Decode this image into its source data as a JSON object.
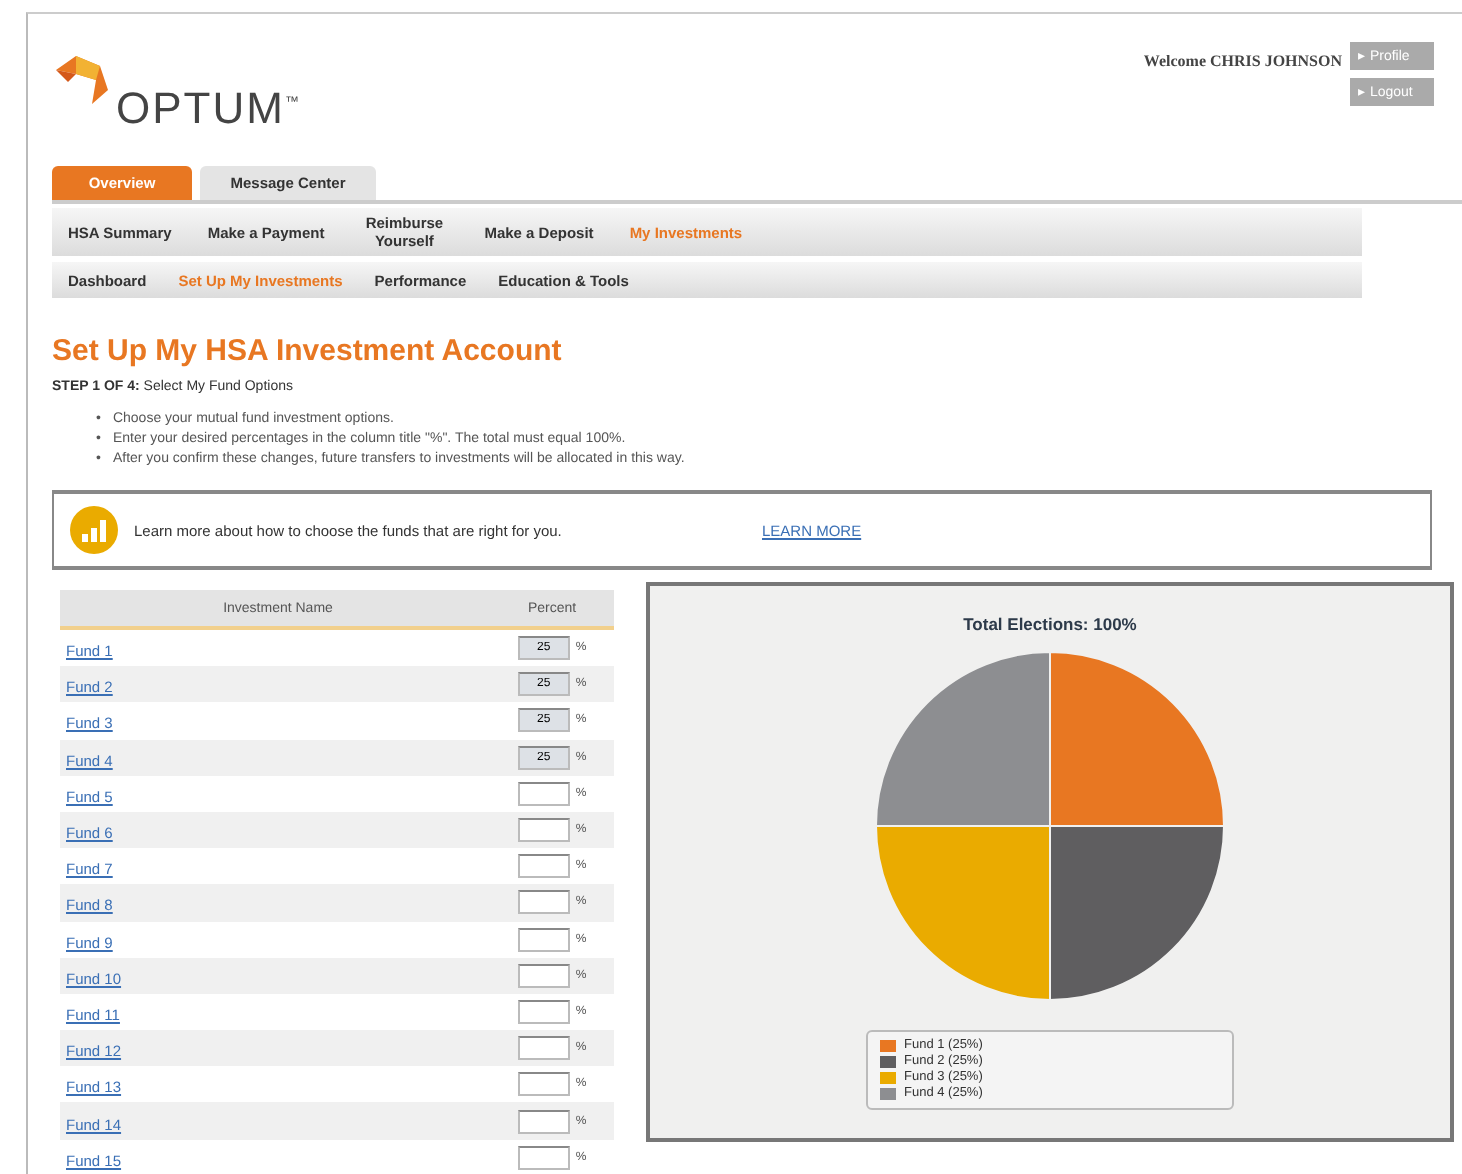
{
  "header": {
    "logo": "OPTUM$^{™}$",
    "welcome": "Welcome CHRIS JOHNSON",
    "buttons": [
      {
        "label": "▸ Profile"
      },
      {
        "label": "▸ Logout"
      }
    ]
  },
  "tabs": [
    {
      "label": "Overview",
      "selected": true
    },
    {
      "label": "Message Center",
      "selected": false
    }
  ],
  "nav": [
    {
      "label": "HSA Summary",
      "selected": false
    },
    {
      "label": "Make a Payment",
      "selected": false
    },
    {
      "label": "Reimburse Yourself",
      "selected": false
    },
    {
      "label": "Make a Deposit",
      "selected": false
    },
    {
      "label": "My Investments",
      "selected": true
    }
  ],
  "subnav": [
    {
      "label": "Dashboard",
      "selected": false
    },
    {
      "label": "Set Up My Investments",
      "selected": true
    },
    {
      "label": "Performance",
      "selected": false
    },
    {
      "label": "Education & Tools",
      "selected": false
    }
  ],
  "title": "Set Up My HSA Investment Account",
  "step": "**STEP 1 OF 4:** Select My Fund Options",
  "bullets": [
    {
      "marker": "•",
      "text": "Choose your mutual fund investment options."
    },
    {
      "marker": "•",
      "text": "Enter your desired percentages in the column title \"%\". The total must equal 100%."
    },
    {
      "marker": "•",
      "text": "After you confirm these changes, future transfers to investments will be allocated in this way."
    }
  ],
  "banner": {
    "text": "Learn more about how to choose the funds that are right for you.",
    "link": "LEARN MORE"
  },
  "table": {
    "columns": [
      "Investment Name",
      "Percent"
    ],
    "unit": "%",
    "rows": [
      {
        "name": "Fund 1",
        "value": "25"
      },
      {
        "name": "Fund 2",
        "value": "25"
      },
      {
        "name": "Fund 3",
        "value": "25"
      },
      {
        "name": "Fund 4",
        "value": "25"
      },
      {
        "name": "Fund 5"
      },
      {
        "name": "Fund 6"
      },
      {
        "name": "Fund 7"
      },
      {
        "name": "Fund 8"
      },
      {
        "name": "Fund 9"
      },
      {
        "name": "Fund 10"
      },
      {
        "name": "Fund 11"
      },
      {
        "name": "Fund 12"
      },
      {
        "name": "Fund 13"
      },
      {
        "name": "Fund 14"
      },
      {
        "name": "Fund 15"
      }
    ]
  },
  "chart": {
    "legend": [
      {
        "label": "Fund 1 (25%)",
        "color": "#e87722"
      },
      {
        "label": "Fund 2 (25%)",
        "color": "#5f5e60"
      },
      {
        "label": "Fund 3 (25%)",
        "color": "#eaab00"
      },
      {
        "label": "Fund 4 (25%)",
        "color": "#8d8e91"
      }
    ],
    "chart_data": {
      "type": "pie",
      "title": "Total Elections: 100%",
      "values": [
        25,
        25,
        25,
        25
      ]
    }
  }
}
